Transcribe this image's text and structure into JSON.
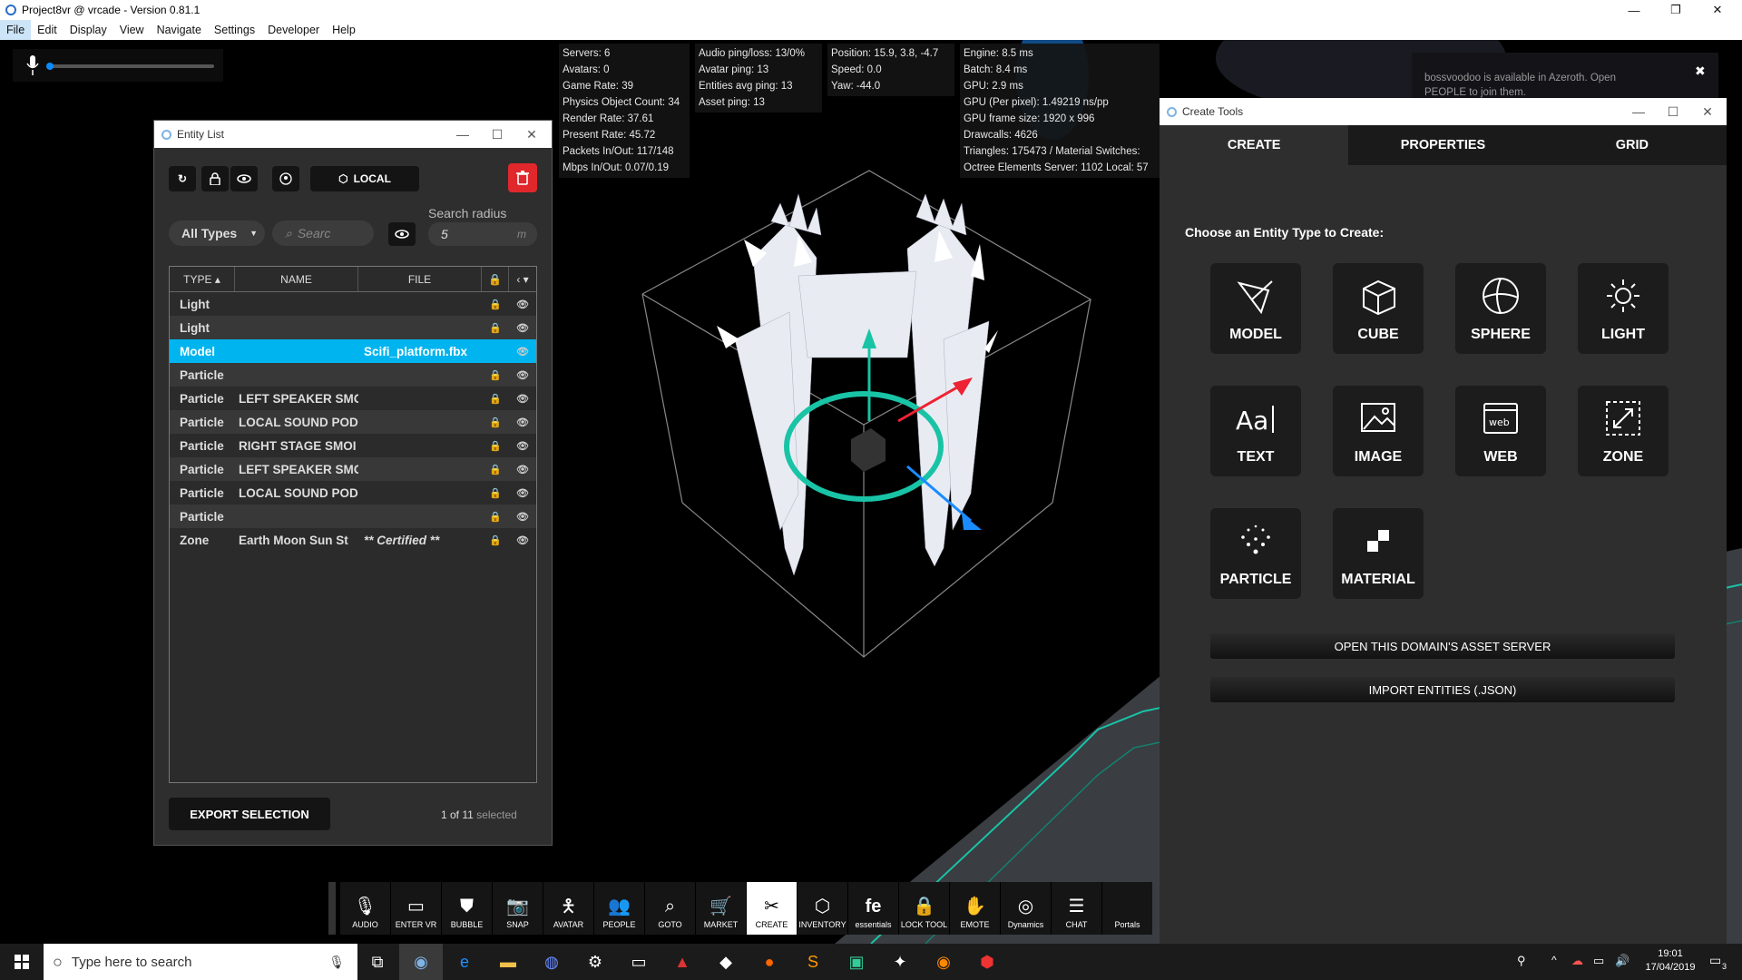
{
  "window": {
    "title": "Project8vr @ vrcade - Version 0.81.1",
    "min": "—",
    "restore": "❐",
    "close": "✕"
  },
  "menu": [
    "File",
    "Edit",
    "Display",
    "View",
    "Navigate",
    "Settings",
    "Developer",
    "Help"
  ],
  "stats": {
    "col1": [
      "Servers: 6",
      "Avatars: 0",
      "Game Rate: 39",
      "Physics Object Count: 34",
      "Render Rate: 37.61",
      "Present Rate: 45.72",
      "Packets In/Out: 117/148",
      "Mbps In/Out: 0.07/0.19"
    ],
    "col2": [
      "Audio ping/loss: 13/0%",
      "Avatar ping: 13",
      "Entities avg ping: 13",
      "Asset ping: 13"
    ],
    "col3": [
      "Position: 15.9, 3.8, -4.7",
      "Speed: 0.0",
      "Yaw: -44.0"
    ],
    "col4": [
      "Engine: 8.5 ms",
      "Batch: 8.4 ms",
      "GPU: 2.9 ms",
      "GPU (Per pixel): 1.49219 ns/pp",
      "GPU frame size: 1920 x 996",
      "Drawcalls: 4626",
      "Triangles: 175473 / Material Switches:",
      "Octree Elements Server: 1102 Local: 57"
    ]
  },
  "notification": {
    "text": "bossvoodoo is available in Azeroth. Open PEOPLE to join them.",
    "close": "✖"
  },
  "entity_list": {
    "title": "Entity List",
    "local_label": "LOCAL",
    "filter_value": "All Types",
    "search_placeholder": "Searc",
    "radius_label": "Search radius",
    "radius_value": "5",
    "radius_unit": "m",
    "headers": {
      "type": "TYPE ▴",
      "name": "NAME",
      "file": "FILE",
      "lock": "🔒",
      "vis": "‹ ▾"
    },
    "rows": [
      {
        "type": "Light",
        "name": "",
        "file": ""
      },
      {
        "type": "Light",
        "name": "",
        "file": ""
      },
      {
        "type": "Model",
        "name": "",
        "file": "Scifi_platform.fbx"
      },
      {
        "type": "Particle",
        "name": "",
        "file": ""
      },
      {
        "type": "Particle",
        "name": "LEFT SPEAKER SMC",
        "file": ""
      },
      {
        "type": "Particle",
        "name": "LOCAL SOUND POD",
        "file": ""
      },
      {
        "type": "Particle",
        "name": "RIGHT STAGE SMOI",
        "file": ""
      },
      {
        "type": "Particle",
        "name": "LEFT SPEAKER SMC",
        "file": ""
      },
      {
        "type": "Particle",
        "name": "LOCAL SOUND POD",
        "file": ""
      },
      {
        "type": "Particle",
        "name": "",
        "file": ""
      },
      {
        "type": "Zone",
        "name": "Earth Moon Sun St",
        "file": "** Certified **"
      }
    ],
    "export_label": "EXPORT SELECTION",
    "selected_count": "1 of 11",
    "selected_suffix": "selected"
  },
  "create_tools": {
    "title": "Create Tools",
    "tabs": [
      "CREATE",
      "PROPERTIES",
      "GRID"
    ],
    "prompt": "Choose an Entity Type to Create:",
    "types": [
      "MODEL",
      "CUBE",
      "SPHERE",
      "LIGHT",
      "TEXT",
      "IMAGE",
      "WEB",
      "ZONE",
      "PARTICLE",
      "MATERIAL"
    ],
    "open_asset_server": "OPEN THIS DOMAIN'S ASSET SERVER",
    "import_entities": "IMPORT ENTITIES (.JSON)"
  },
  "toolbar": [
    "AUDIO",
    "ENTER VR",
    "BUBBLE",
    "SNAP",
    "AVATAR",
    "PEOPLE",
    "GOTO",
    "MARKET",
    "CREATE",
    "INVENTORY",
    "essentials",
    "LOCK TOOL",
    "EMOTE",
    "Dynamics",
    "CHAT",
    "Portals"
  ],
  "taskbar": {
    "search_placeholder": "Type here to search",
    "time": "19:01",
    "date": "17/04/2019",
    "notif_count": "3"
  },
  "colors": {
    "accent": "#00b4ef",
    "delete": "#e0272c",
    "teal": "#19c3a6"
  }
}
